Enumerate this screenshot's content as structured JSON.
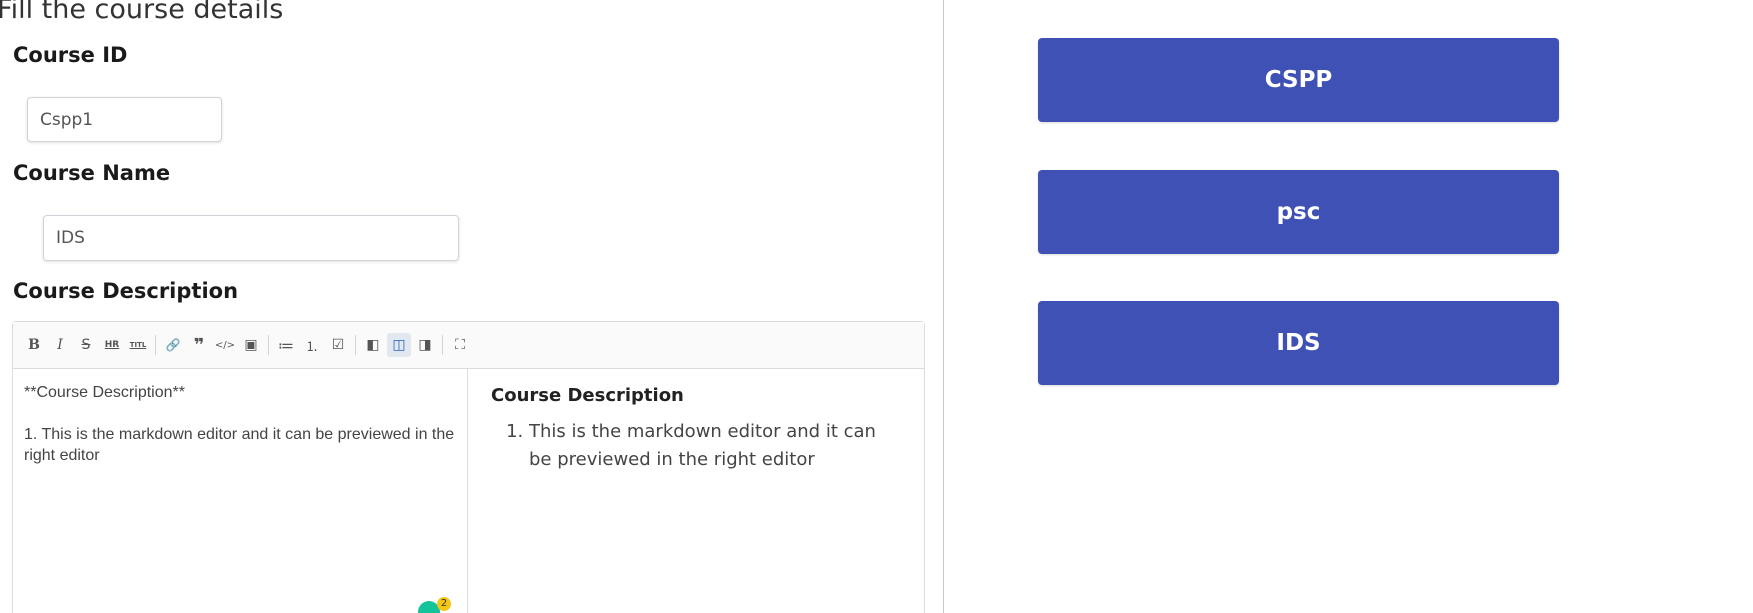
{
  "form": {
    "title": "Fill the course details",
    "course_id_label": "Course ID",
    "course_id_value": "Cspp1",
    "course_name_label": "Course Name",
    "course_name_value": "IDS",
    "course_description_label": "Course Description"
  },
  "editor": {
    "toolbar": [
      {
        "name": "bold-icon",
        "glyph": "B"
      },
      {
        "name": "italic-icon",
        "glyph": "I"
      },
      {
        "name": "strikethrough-icon",
        "glyph": "S"
      },
      {
        "name": "horizontal-rule-icon",
        "glyph": "HR"
      },
      {
        "name": "title-icon",
        "glyph": "TITL"
      },
      {
        "name": "link-icon",
        "glyph": "🔗"
      },
      {
        "name": "quote-icon",
        "glyph": "❞"
      },
      {
        "name": "code-icon",
        "glyph": "</>"
      },
      {
        "name": "image-icon",
        "glyph": "▣"
      },
      {
        "name": "unordered-list-icon",
        "glyph": "≔"
      },
      {
        "name": "ordered-list-icon",
        "glyph": "⒈"
      },
      {
        "name": "checklist-icon",
        "glyph": "☑"
      },
      {
        "name": "edit-mode-icon",
        "glyph": "◧"
      },
      {
        "name": "live-mode-icon",
        "glyph": "◫"
      },
      {
        "name": "preview-mode-icon",
        "glyph": "◨"
      },
      {
        "name": "fullscreen-icon",
        "glyph": "⛶"
      }
    ],
    "source": {
      "line1": "**Course Description**",
      "line2": "1. This is the markdown editor and it can be previewed in the right editor"
    },
    "preview": {
      "heading": "Course Description",
      "item1": "This is the markdown editor and it can be previewed in the right editor"
    },
    "grammarly_count": "2"
  },
  "courses": {
    "items": [
      {
        "label": "CSPP"
      },
      {
        "label": "psc"
      },
      {
        "label": "IDS"
      }
    ],
    "button_color": "#3f51b5"
  }
}
